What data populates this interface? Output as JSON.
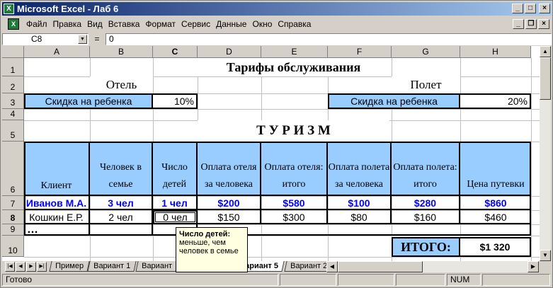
{
  "window": {
    "title": "Microsoft Excel - Лаб 6",
    "min_icon": "minimize-icon",
    "max_icon": "maximize-icon",
    "close_icon": "close-icon"
  },
  "menu": [
    "Файл",
    "Правка",
    "Вид",
    "Вставка",
    "Формат",
    "Сервис",
    "Данные",
    "Окно",
    "Справка"
  ],
  "formula": {
    "namebox": "C8",
    "eq": "=",
    "value": "0"
  },
  "columns": [
    "A",
    "B",
    "C",
    "D",
    "E",
    "F",
    "G",
    "H"
  ],
  "rows": [
    "1",
    "2",
    "3",
    "4",
    "5",
    "6",
    "7",
    "8",
    "9",
    "10"
  ],
  "sheet": {
    "title": "Тарифы обслуживания",
    "hotel_label": "Отель",
    "flight_label": "Полет",
    "discount_label": "Скидка на ребенка",
    "hotel_discount": "10%",
    "flight_discount": "20%",
    "tourism": "Т У Р И З М",
    "headers": [
      "Клиент",
      "Человек в семье",
      "Число детей",
      "Оплата отеля за человека",
      "Оплата отеля: итого",
      "Оплата полета за человека",
      "Оплата полета: итого",
      "Цена путевки"
    ],
    "row7": [
      "Иванов М.А.",
      "3 чел",
      "1 чел",
      "$200",
      "$580",
      "$100",
      "$280",
      "$860"
    ],
    "row8": [
      "Кошкин Е.Р.",
      "2 чел",
      "0 чел",
      "$150",
      "$300",
      "$80",
      "$160",
      "$460"
    ],
    "row9": "…",
    "total_label": "ИТОГО:",
    "total_value": "$1 320"
  },
  "comment": {
    "title": "Число детей:",
    "text": "меньше, чем человек в семье"
  },
  "sheet_tabs": [
    "Пример",
    "Вариант 1",
    "Вариант",
    "ариант 5",
    "Вариант 2"
  ],
  "status": {
    "ready": "Готово",
    "num": "NUM"
  },
  "colors": {
    "header_blue": "#99ccff",
    "data_blue": "#0000ff"
  }
}
